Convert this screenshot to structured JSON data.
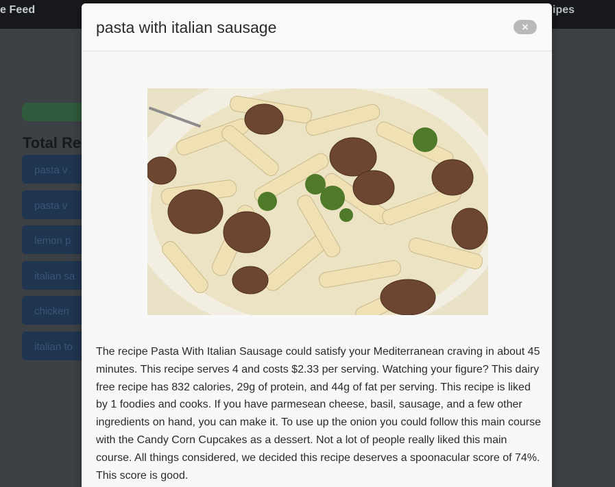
{
  "background": {
    "nav_left_text": "e Feed",
    "nav_right_text": "ipes",
    "heading": "Total Re",
    "list_items": [
      "pasta v",
      "pasta v",
      "lemon p",
      "italian sa",
      "chicken",
      "italian to"
    ]
  },
  "modal": {
    "title": "pasta with italian sausage",
    "close_label": "×",
    "image_alt": "pasta with italian sausage photo",
    "summary": "The recipe Pasta With Italian Sausage could satisfy your Mediterranean craving in about 45 minutes. This recipe serves 4 and costs $2.33 per serving. Watching your figure? This dairy free recipe has 832 calories, 29g of protein, and 44g of fat per serving. This recipe is liked by 1 foodies and cooks. If you have parmesean cheese, basil, sausage, and a few other ingredients on hand, you can make it. To use up the onion you could follow this main course with the Candy Corn Cupcakes as a dessert. Not a lot of people really liked this main course. All things considered, we decided this recipe deserves a spoonacular score of 74%. This score is good."
  },
  "colors": {
    "overlay": "#3d4045",
    "topbar": "#17191c",
    "modal_bg": "#f8f8f8",
    "close_btn": "#b9b9b9"
  }
}
